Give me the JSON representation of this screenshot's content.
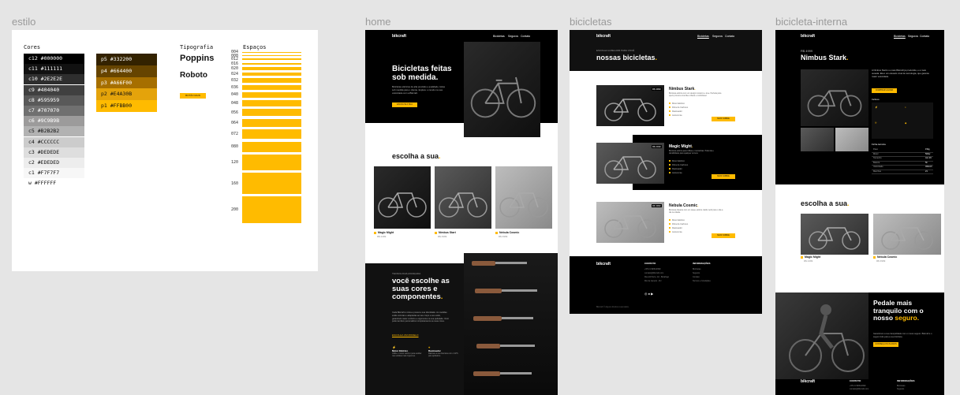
{
  "frames": {
    "estilo": "estilo",
    "home": "home",
    "bicicletas": "bicicletas",
    "interna": "bicicleta-interna"
  },
  "estilo": {
    "cores_title": "Cores",
    "tipografia_title": "Tipografia",
    "espacos_title": "Espaços",
    "colors_left": [
      {
        "label": "c12 #000000",
        "bg": "#000000",
        "fg": "#ffffff"
      },
      {
        "label": "c11 #111111",
        "bg": "#111111",
        "fg": "#ffffff"
      },
      {
        "label": "c10 #2E2E2E",
        "bg": "#2E2E2E",
        "fg": "#ffffff"
      },
      {
        "label": "c9 #404040",
        "bg": "#404040",
        "fg": "#ffffff"
      },
      {
        "label": "c8 #595959",
        "bg": "#595959",
        "fg": "#ffffff"
      },
      {
        "label": "c7 #707070",
        "bg": "#707070",
        "fg": "#ffffff"
      },
      {
        "label": "c6 #9C9B9B",
        "bg": "#9C9B9B",
        "fg": "#ffffff"
      },
      {
        "label": "c5 #B2B2B2",
        "bg": "#B2B2B2",
        "fg": "#111111"
      },
      {
        "label": "c4 #CCCCCC",
        "bg": "#CCCCCC",
        "fg": "#111111"
      },
      {
        "label": "c3 #DEDEDE",
        "bg": "#DEDEDE",
        "fg": "#111111"
      },
      {
        "label": "c2 #EDEDED",
        "bg": "#EDEDED",
        "fg": "#111111"
      },
      {
        "label": "c1 #F7F7F7",
        "bg": "#F7F7F7",
        "fg": "#111111"
      },
      {
        "label": "w #FFFFFF",
        "bg": "#FFFFFF",
        "fg": "#111111"
      }
    ],
    "colors_right": [
      {
        "label": "p5 #332200",
        "bg": "#332200",
        "fg": "#ffffff"
      },
      {
        "label": "p4 #664400",
        "bg": "#664400",
        "fg": "#ffffff"
      },
      {
        "label": "p3 #A66F00",
        "bg": "#A66F00",
        "fg": "#ffffff"
      },
      {
        "label": "p2 #E4A30B",
        "bg": "#E4A30B",
        "fg": "#111111"
      },
      {
        "label": "p1 #FFBB00",
        "bg": "#FFBB00",
        "fg": "#111111"
      }
    ],
    "fonts": [
      "Poppins",
      "Roboto"
    ],
    "sample_button": "BOTÃO MAIN",
    "spacing": [
      "004",
      "008",
      "012",
      "016",
      "020",
      "024",
      "032",
      "036",
      "040",
      "048",
      "056",
      "064",
      "072",
      "080",
      "120",
      "160",
      "200"
    ]
  },
  "home": {
    "logo": "bikcraft",
    "nav": [
      "Bicicletas",
      "Seguros",
      "Contato"
    ],
    "hero_title": "Bicicletas feitas sob medida.",
    "hero_text": "Bicicletas elétricas de alta precisão e qualidade, feitas sob medida para o cliente. Explore o mundo na sua velocidade com a Bikcraft.",
    "hero_button": "ESCOLHA A SUA",
    "choose_title": "escolha a sua",
    "bikes": [
      {
        "name": "Magic Might",
        "price": "R$ 2499"
      },
      {
        "name": "Nimbus Start",
        "price": "R$ 4999"
      },
      {
        "name": "Nebula Cosmic",
        "price": "R$ 3999"
      }
    ],
    "tech_label": "TECNOLOGIA AVANÇADA",
    "tech_title": "você escolhe as suas cores e componentes",
    "tech_text": "Cada Bikcraft é única e possui a sua identidade. As medidas estão corretas e adaptadas ao seu corpo e seu estilo, garantindo maior conforto e ergonomia na sua pedalada. Você pode também personalizar completamente as suas cores.",
    "tech_link": "ESCOLHA UM MODELO",
    "features": [
      {
        "title": "Motor Elétrico",
        "text": "Utilize o motor elétrico para auxiliar nas subidas mais íngremes."
      },
      {
        "title": "Rastreador",
        "text": "Rastreie a sua bicicleta com o GPS pelo aplicativo."
      }
    ]
  },
  "bicicletas": {
    "logo": "bikcraft",
    "nav": [
      "Bicicletas",
      "Seguros",
      "Contato"
    ],
    "sub": "ESCOLHA A MELHOR PARA VOCÊ",
    "title": "nossas bicicletas",
    "items": [
      {
        "name": "Nimbus Stark",
        "price": "R$ 4999",
        "text": "Bicicleta elétrica com um design moderno e leve. Perfeita para quem procura uma bike urbana e confortável.",
        "features": [
          "Motor Elétrico",
          "Fibra de Carbono",
          "Rastreador",
          "Autonomia"
        ],
        "button": "MAIS SOBRE"
      },
      {
        "name": "Magic Might",
        "price": "R$ 2499",
        "text": "Bicicleta elétrica para trilhas e montanhas. Potência e durabilidade para qualquer terreno.",
        "features": [
          "Motor Elétrico",
          "Fibra de Carbono",
          "Rastreador",
          "Autonomia"
        ],
        "button": "MAIS SOBRE"
      },
      {
        "name": "Nebula Cosmic",
        "price": "R$ 3999",
        "text": "Bicicleta clássica com um toque elétrico. Estilo retrô para o dia a dia na cidade.",
        "features": [
          "Motor Elétrico",
          "Fibra de Carbono",
          "Rastreador",
          "Autonomia"
        ],
        "button": "MAIS SOBRE"
      }
    ],
    "footer": {
      "logo": "bikcraft",
      "contato_title": "CONTATO",
      "contato": [
        "+55 21 9999-9999",
        "contato@bikcraft.com",
        "Rua Ali Perto, 42 - Botafogo",
        "Rio de Janeiro - RJ"
      ],
      "info_title": "INFORMAÇÕES",
      "info": [
        "Bicicletas",
        "Seguros",
        "Contato",
        "Termos e Condições"
      ],
      "copy": "Bikcraft © Alguns direitos reservados."
    }
  },
  "interna": {
    "logo": "bikcraft",
    "nav": [
      "Bicicletas",
      "Seguros",
      "Contato"
    ],
    "price": "R$ 4999",
    "title": "Nimbus Stark",
    "text": "A Nimbus Stark é a mais Bikcraft já produzida, e a mais ousada. Ela é um elevado nível de tecnologia, que garante maior velocidade.",
    "button": "COMPRAR AGORA",
    "includes_label": "Incluso",
    "specs_label": "Ficha técnica",
    "specs": [
      {
        "k": "Peso",
        "v": "15kg"
      },
      {
        "k": "Motor",
        "v": "500w"
      },
      {
        "k": "Tamanho",
        "v": "Aro 29"
      },
      {
        "k": "Bateria",
        "v": "5h"
      },
      {
        "k": "Velocidade",
        "v": "40km/h"
      },
      {
        "k": "Marchas",
        "v": "21"
      }
    ],
    "choose_title": "escolha a sua",
    "bikes": [
      {
        "name": "Magic Might",
        "price": "R$ 2499"
      },
      {
        "name": "Nebula Cosmic",
        "price": "R$ 3999"
      }
    ],
    "seguro_title_a": "Pedale mais tranquilo com o nosso",
    "seguro_title_b": "seguro",
    "seguro_text": "Garantimos a sua tranquilidade com o nosso seguro. Bikcraft é o seguro feito para a sua bicicleta.",
    "seguro_button": "CONHEÇA OS PLANOS",
    "footer": {
      "logo": "bikcraft",
      "contato_title": "CONTATO",
      "info_title": "INFORMAÇÕES",
      "contato": [
        "+55 21 9999-9999",
        "contato@bikcraft.com"
      ],
      "info": [
        "Bicicletas",
        "Seguros"
      ]
    }
  },
  "colors": {
    "accent": "#FFBB00",
    "dark": "#000000",
    "bg": "#E5E5E5"
  }
}
